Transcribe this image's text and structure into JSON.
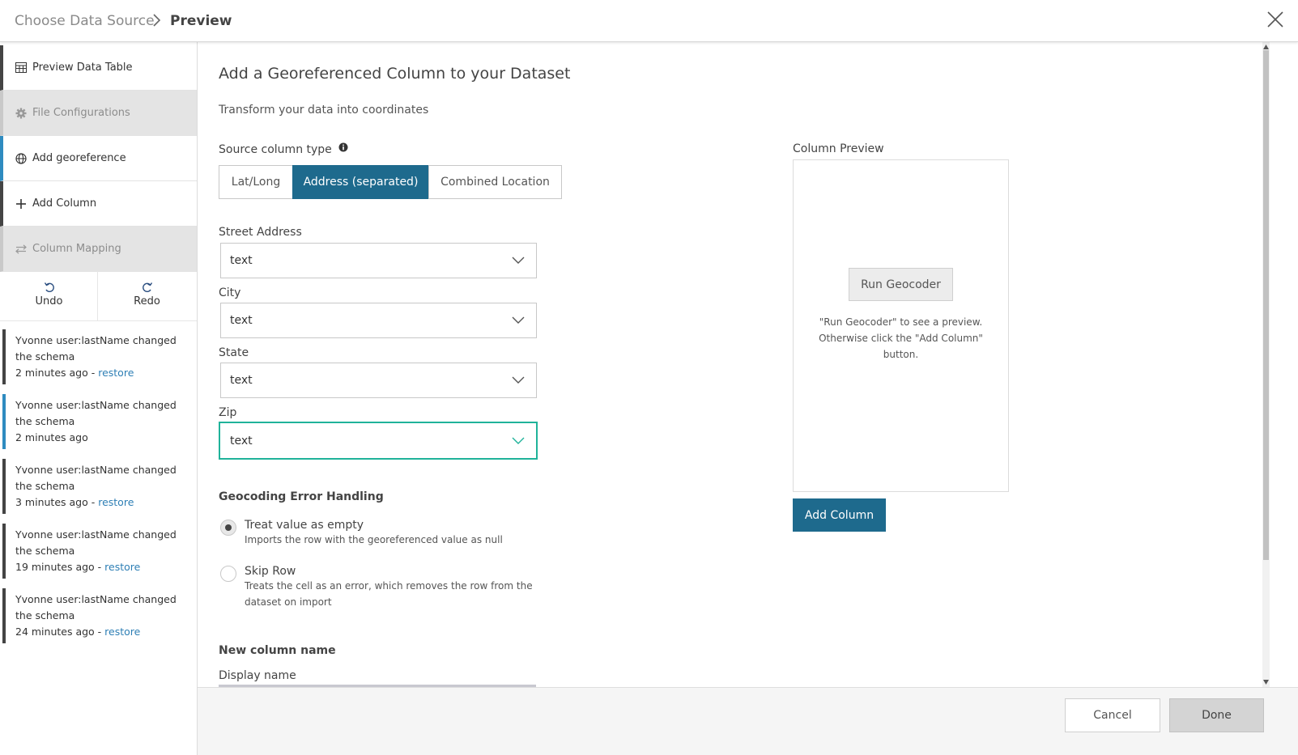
{
  "header": {
    "breadcrumb_1": "Choose Data Source",
    "breadcrumb_sep": ">",
    "breadcrumb_2": "Preview"
  },
  "sidebar": {
    "items": [
      {
        "label": "Preview Data Table",
        "icon": "table-icon",
        "state": "normal"
      },
      {
        "label": "File Configurations",
        "icon": "gear-icon",
        "state": "disabled"
      },
      {
        "label": "Add georeference",
        "icon": "globe-icon",
        "state": "active"
      },
      {
        "label": "Add Column",
        "icon": "plus-icon",
        "state": "normal"
      },
      {
        "label": "Column Mapping",
        "icon": "swap-icon",
        "state": "disabled"
      }
    ],
    "undo_label": "Undo",
    "redo_label": "Redo",
    "history": [
      {
        "text": "Yvonne user:lastName changed the schema",
        "time": "2 minutes ago",
        "restore": "restore",
        "current": false
      },
      {
        "text": "Yvonne user:lastName changed the schema",
        "time": "2 minutes ago",
        "restore": "",
        "current": true
      },
      {
        "text": "Yvonne user:lastName changed the schema",
        "time": "3 minutes ago",
        "restore": "restore",
        "current": false
      },
      {
        "text": "Yvonne user:lastName changed the schema",
        "time": "19 minutes ago",
        "restore": "restore",
        "current": false
      },
      {
        "text": "Yvonne user:lastName changed the schema",
        "time": "24 minutes ago",
        "restore": "restore",
        "current": false
      }
    ]
  },
  "main": {
    "title": "Add a Georeferenced Column to your Dataset",
    "subtitle": "Transform your data into coordinates",
    "source_type_label": "Source column type",
    "source_types": [
      "Lat/Long",
      "Address (separated)",
      "Combined Location"
    ],
    "selected_source_type": "Address (separated)",
    "fields": [
      {
        "label": "Street Address",
        "value": "text"
      },
      {
        "label": "City",
        "value": "text"
      },
      {
        "label": "State",
        "value": "text"
      },
      {
        "label": "Zip",
        "value": "text"
      }
    ],
    "error_handling_label": "Geocoding Error Handling",
    "error_options": [
      {
        "label": "Treat value as empty",
        "help": "Imports the row with the georeferenced value as null",
        "checked": true
      },
      {
        "label": "Skip Row",
        "help": "Treats the cell as an error, which removes the row from the dataset on import",
        "checked": false
      }
    ],
    "new_column_label": "New column name",
    "display_name_label": "Display name"
  },
  "preview": {
    "label": "Column Preview",
    "run_geocoder": "Run Geocoder",
    "help": "\"Run Geocoder\" to see a preview. Otherwise click the \"Add Column\" button.",
    "add_column": "Add Column"
  },
  "footer": {
    "cancel": "Cancel",
    "done": "Done"
  },
  "colors": {
    "accent": "#1e6a8d",
    "active_border": "#2e8bc0",
    "focus_border": "#20b39a",
    "link": "#2e7fb5"
  }
}
